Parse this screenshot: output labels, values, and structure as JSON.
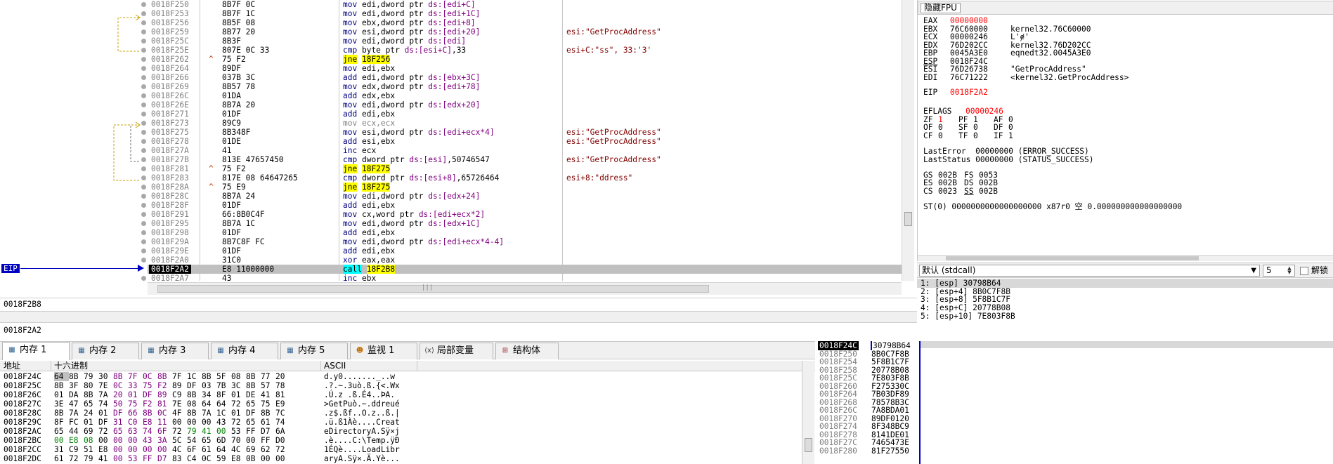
{
  "disasm": {
    "rows": [
      {
        "addr": "0018F250",
        "bytes": "8B7F 0C",
        "ins": "mov edi,dword ptr ds:[edi+C]",
        "comment": ""
      },
      {
        "addr": "0018F253",
        "bytes": "8B7F 1C",
        "ins": "mov edi,dword ptr ds:[edi+1C]",
        "comment": ""
      },
      {
        "addr": "0018F256",
        "bytes": "8B5F 08",
        "ins": "mov ebx,dword ptr ds:[edi+8]",
        "comment": ""
      },
      {
        "addr": "0018F259",
        "bytes": "8B77 20",
        "ins": "mov esi,dword ptr ds:[edi+20]",
        "comment": "esi:\"GetProcAddress\""
      },
      {
        "addr": "0018F25C",
        "bytes": "8B3F",
        "ins": "mov edi,dword ptr ds:[edi]",
        "comment": ""
      },
      {
        "addr": "0018F25E",
        "bytes": "807E 0C 33",
        "ins": "cmp byte ptr ds:[esi+C],33",
        "comment": "esi+C:\"ss\", 33:'3'"
      },
      {
        "addr": "0018F262",
        "jmp": "^",
        "bytes": "75 F2",
        "ins": "jne 18F256",
        "comment": ""
      },
      {
        "addr": "0018F264",
        "bytes": "89DF",
        "ins": "mov edi,ebx",
        "comment": ""
      },
      {
        "addr": "0018F266",
        "bytes": "037B 3C",
        "ins": "add edi,dword ptr ds:[ebx+3C]",
        "comment": ""
      },
      {
        "addr": "0018F269",
        "bytes": "8B57 78",
        "ins": "mov edx,dword ptr ds:[edi+78]",
        "comment": ""
      },
      {
        "addr": "0018F26C",
        "bytes": "01DA",
        "ins": "add edx,ebx",
        "comment": ""
      },
      {
        "addr": "0018F26E",
        "bytes": "8B7A 20",
        "ins": "mov edi,dword ptr ds:[edx+20]",
        "comment": ""
      },
      {
        "addr": "0018F271",
        "bytes": "01DF",
        "ins": "add edi,ebx",
        "comment": ""
      },
      {
        "addr": "0018F273",
        "bytes": "89C9",
        "ins": "mov ecx,ecx",
        "comment": ""
      },
      {
        "addr": "0018F275",
        "bytes": "8B348F",
        "ins": "mov esi,dword ptr ds:[edi+ecx*4]",
        "comment": "esi:\"GetProcAddress\""
      },
      {
        "addr": "0018F278",
        "bytes": "01DE",
        "ins": "add esi,ebx",
        "comment": "esi:\"GetProcAddress\""
      },
      {
        "addr": "0018F27A",
        "bytes": "41",
        "ins": "inc ecx",
        "comment": ""
      },
      {
        "addr": "0018F27B",
        "bytes": "813E 47657450",
        "ins": "cmp dword ptr ds:[esi],50746547",
        "comment": "esi:\"GetProcAddress\""
      },
      {
        "addr": "0018F281",
        "jmp": "^",
        "bytes": "75 F2",
        "ins": "jne 18F275",
        "comment": ""
      },
      {
        "addr": "0018F283",
        "bytes": "817E 08 64647265",
        "ins": "cmp dword ptr ds:[esi+8],65726464",
        "comment": "esi+8:\"ddress\""
      },
      {
        "addr": "0018F28A",
        "jmp": "^",
        "bytes": "75 E9",
        "ins": "jne 18F275",
        "comment": ""
      },
      {
        "addr": "0018F28C",
        "bytes": "8B7A 24",
        "ins": "mov edi,dword ptr ds:[edx+24]",
        "comment": ""
      },
      {
        "addr": "0018F28F",
        "bytes": "01DF",
        "ins": "add edi,ebx",
        "comment": ""
      },
      {
        "addr": "0018F291",
        "bytes": "66:8B0C4F",
        "ins": "mov cx,word ptr ds:[edi+ecx*2]",
        "comment": ""
      },
      {
        "addr": "0018F295",
        "bytes": "8B7A 1C",
        "ins": "mov edi,dword ptr ds:[edx+1C]",
        "comment": ""
      },
      {
        "addr": "0018F298",
        "bytes": "01DF",
        "ins": "add edi,ebx",
        "comment": ""
      },
      {
        "addr": "0018F29A",
        "bytes": "8B7C8F FC",
        "ins": "mov edi,dword ptr ds:[edi+ecx*4-4]",
        "comment": ""
      },
      {
        "addr": "0018F29E",
        "bytes": "01DF",
        "ins": "add edi,ebx",
        "comment": ""
      },
      {
        "addr": "0018F2A0",
        "bytes": "31C0",
        "ins": "xor eax,eax",
        "comment": ""
      },
      {
        "addr": "0018F2A2",
        "bytes": "E8 11000000",
        "ins": "call 18F2B8",
        "comment": "",
        "current": true
      },
      {
        "addr": "0018F2A7",
        "bytes": "43",
        "ins": "inc ebx",
        "comment": ""
      }
    ],
    "eip_label": "EIP",
    "hscroll_glyph": "|||"
  },
  "info": {
    "line1": "0018F2B8",
    "line2": "0018F2A2"
  },
  "dump": {
    "tabs": [
      {
        "label": "内存 1",
        "icon": "memory-icon",
        "active": true
      },
      {
        "label": "内存 2",
        "icon": "memory-icon"
      },
      {
        "label": "内存 3",
        "icon": "memory-icon"
      },
      {
        "label": "内存 4",
        "icon": "memory-icon"
      },
      {
        "label": "内存 5",
        "icon": "memory-icon"
      },
      {
        "label": "监视 1",
        "icon": "watch-icon"
      },
      {
        "label": "局部变量",
        "icon": "locals-icon"
      },
      {
        "label": "结构体",
        "icon": "struct-icon"
      }
    ],
    "headers": {
      "address": "地址",
      "hex": "十六进制",
      "ascii": "ASCII"
    },
    "rows": [
      {
        "addr": "0018F24C",
        "hex": [
          "64",
          "8B",
          "79",
          "30",
          "8B",
          "7F",
          "0C",
          "8B",
          "7F",
          "1C",
          "8B",
          "5F",
          "08",
          "8B",
          "77",
          "20"
        ],
        "ascii": "d.y0......._..w "
      },
      {
        "addr": "0018F25C",
        "hex": [
          "8B",
          "3F",
          "80",
          "7E",
          "0C",
          "33",
          "75",
          "F2",
          "89",
          "DF",
          "03",
          "7B",
          "3C",
          "8B",
          "57",
          "78"
        ],
        "ascii": ".?.~.3uò.ß.{<.Wx"
      },
      {
        "addr": "0018F26C",
        "hex": [
          "01",
          "DA",
          "8B",
          "7A",
          "20",
          "01",
          "DF",
          "89",
          "C9",
          "8B",
          "34",
          "8F",
          "01",
          "DE",
          "41",
          "81"
        ],
        "ascii": ".Ú.z .ß.É4..ÞA."
      },
      {
        "addr": "0018F27C",
        "hex": [
          "3E",
          "47",
          "65",
          "74",
          "50",
          "75",
          "F2",
          "81",
          "7E",
          "08",
          "64",
          "64",
          "72",
          "65",
          "75",
          "E9"
        ],
        "ascii": ">GetPuò.~.ddreué"
      },
      {
        "addr": "0018F28C",
        "hex": [
          "8B",
          "7A",
          "24",
          "01",
          "DF",
          "66",
          "8B",
          "0C",
          "4F",
          "8B",
          "7A",
          "1C",
          "01",
          "DF",
          "8B",
          "7C"
        ],
        "ascii": ".z$.ßf..O.z..ß.|"
      },
      {
        "addr": "0018F29C",
        "hex": [
          "8F",
          "FC",
          "01",
          "DF",
          "31",
          "C0",
          "E8",
          "11",
          "00",
          "00",
          "00",
          "43",
          "72",
          "65",
          "61",
          "74"
        ],
        "ascii": ".ü.ß1Àè....Creat"
      },
      {
        "addr": "0018F2AC",
        "hex": [
          "65",
          "44",
          "69",
          "72",
          "65",
          "63",
          "74",
          "6F",
          "72",
          "79",
          "41",
          "00",
          "53",
          "FF",
          "D7",
          "6A"
        ],
        "ascii": "eDirectoryA.Sÿ×j"
      },
      {
        "addr": "0018F2BC",
        "hex": [
          "00",
          "E8",
          "08",
          "00",
          "00",
          "00",
          "43",
          "3A",
          "5C",
          "54",
          "65",
          "6D",
          "70",
          "00",
          "FF",
          "D0"
        ],
        "ascii": ".è....C:\\Temp.ÿÐ"
      },
      {
        "addr": "0018F2CC",
        "hex": [
          "31",
          "C9",
          "51",
          "E8",
          "00",
          "00",
          "00",
          "00",
          "4C",
          "6F",
          "61",
          "64",
          "4C",
          "69",
          "62",
          "72"
        ],
        "ascii": "1ÉQè....LoadLibr"
      },
      {
        "addr": "0018F2DC",
        "hex": [
          "61",
          "72",
          "79",
          "41",
          "00",
          "53",
          "FF",
          "D7",
          "83",
          "C4",
          "0C",
          "59",
          "E8",
          "0B",
          "00",
          "00"
        ],
        "ascii": "aryA.Sÿ×.Ä.Yè..."
      }
    ]
  },
  "stack": {
    "rows": [
      {
        "addr": "0018F24C",
        "val": "30798B64",
        "current": true
      },
      {
        "addr": "0018F250",
        "val": "8B0C7F8B"
      },
      {
        "addr": "0018F254",
        "val": "5F8B1C7F"
      },
      {
        "addr": "0018F258",
        "val": "20778B08"
      },
      {
        "addr": "0018F25C",
        "val": "7E803F8B"
      },
      {
        "addr": "0018F260",
        "val": "F275330C"
      },
      {
        "addr": "0018F264",
        "val": "7B03DF89"
      },
      {
        "addr": "0018F268",
        "val": "78578B3C"
      },
      {
        "addr": "0018F26C",
        "val": "7A8BDA01"
      },
      {
        "addr": "0018F270",
        "val": "89DF0120"
      },
      {
        "addr": "0018F274",
        "val": "8F348BC9"
      },
      {
        "addr": "0018F278",
        "val": "8141DE01"
      },
      {
        "addr": "0018F27C",
        "val": "7465473E"
      },
      {
        "addr": "0018F280",
        "val": "81F27550"
      }
    ]
  },
  "registers": {
    "title": "隐藏FPU",
    "lines": [
      {
        "name": "EAX",
        "value": "00000000",
        "comment": "",
        "changed": true
      },
      {
        "name": "EBX",
        "value": "76C60000",
        "comment": "kernel32.76C60000"
      },
      {
        "name": "ECX",
        "value": "00000246",
        "comment": "L'ɇ'"
      },
      {
        "name": "EDX",
        "value": "76D202CC",
        "comment": "kernel32.76D202CC"
      },
      {
        "name": "EBP",
        "value": "0045A3E0",
        "comment": "eqnedt32.0045A3E0"
      },
      {
        "name": "ESP",
        "value": "0018F24C",
        "comment": "",
        "underline": true
      },
      {
        "name": "ESI",
        "value": "76D26738",
        "comment": "\"GetProcAddress\""
      },
      {
        "name": "EDI",
        "value": "76C71222",
        "comment": "<kernel32.GetProcAddress>"
      }
    ],
    "eip": {
      "name": "EIP",
      "value": "0018F2A2"
    },
    "eflags": {
      "name": "EFLAGS",
      "value": "00000246"
    },
    "flags_rows": [
      [
        {
          "n": "ZF",
          "v": "1",
          "red": true
        },
        {
          "n": "PF",
          "v": "1"
        },
        {
          "n": "AF",
          "v": "0"
        }
      ],
      [
        {
          "n": "OF",
          "v": "0"
        },
        {
          "n": "SF",
          "v": "0"
        },
        {
          "n": "DF",
          "v": "0"
        }
      ],
      [
        {
          "n": "CF",
          "v": "0"
        },
        {
          "n": "TF",
          "v": "0"
        },
        {
          "n": "IF",
          "v": "1"
        }
      ]
    ],
    "last_error": "LastError  00000000 (ERROR_SUCCESS)",
    "last_status": "LastStatus 00000000 (STATUS_SUCCESS)",
    "segs": [
      [
        {
          "n": "GS",
          "v": "002B"
        },
        {
          "n": "FS",
          "v": "0053"
        }
      ],
      [
        {
          "n": "ES",
          "v": "002B"
        },
        {
          "n": "DS",
          "v": "002B"
        }
      ],
      [
        {
          "n": "CS",
          "v": "0023"
        },
        {
          "n": "SS",
          "v": "002B",
          "underline": true
        }
      ]
    ],
    "st0": "ST(0) 0000000000000000000 x87r0 空 0.000000000000000000"
  },
  "callconv": {
    "selected": "默认 (stdcall)",
    "count": "5",
    "checkbox_label": "解锁",
    "args": [
      "1: [esp] 30798B64",
      "2: [esp+4] 8B0C7F8B",
      "3: [esp+8] 5F8B1C7F",
      "4: [esp+C] 20778B08",
      "5: [esp+10] 7E803F8B"
    ]
  },
  "colors": {
    "eip_blue": "#0000c0",
    "jne_yellow": "#ffff00",
    "call_cyan": "#00ffff",
    "changed_red": "#ff0000",
    "comment_brown": "#800000"
  }
}
